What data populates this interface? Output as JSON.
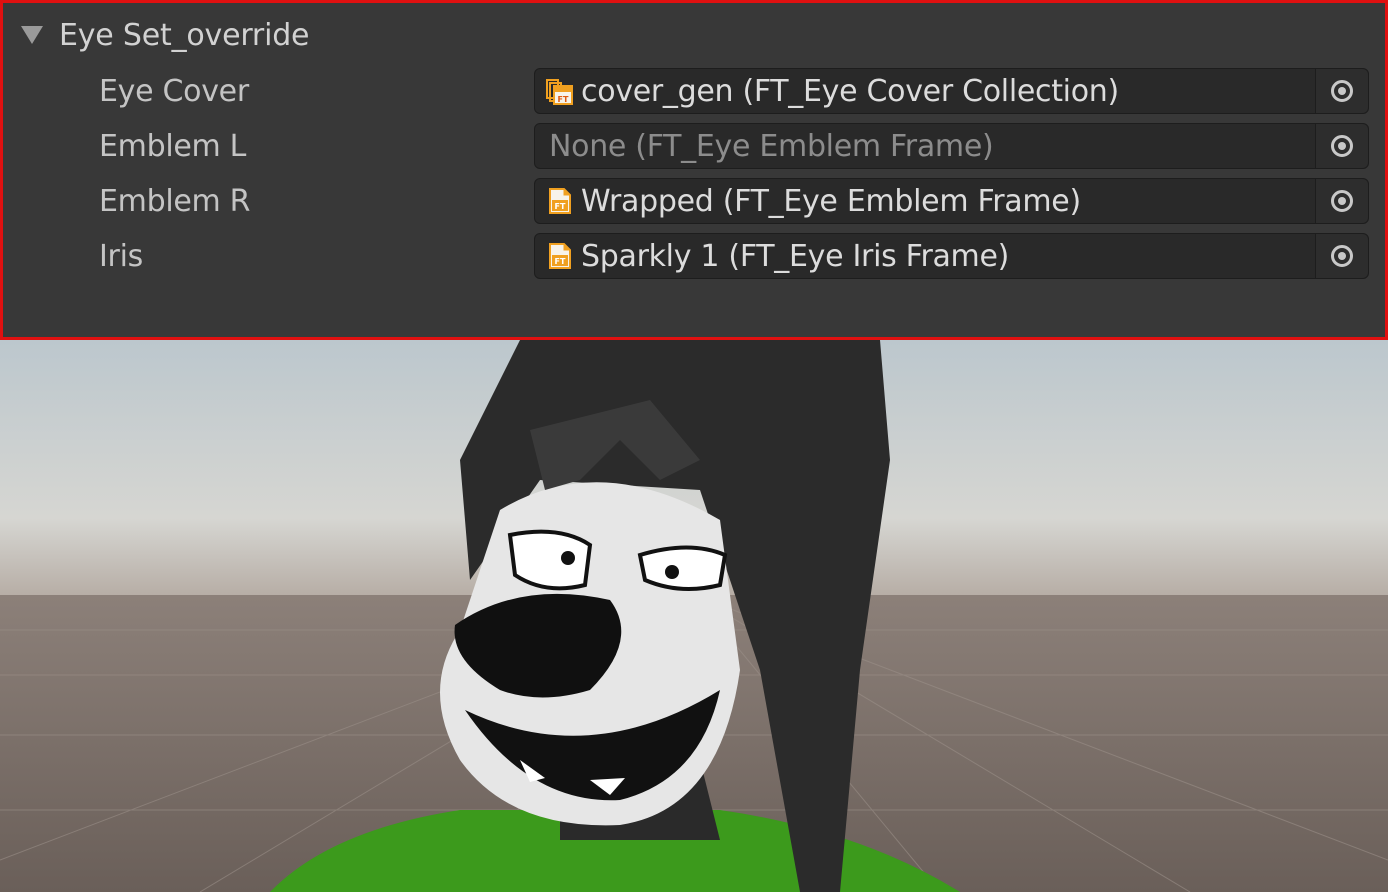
{
  "inspector": {
    "foldout": {
      "title": "Eye Set_override",
      "icon": "triangle-down-icon"
    },
    "fields": [
      {
        "label": "Eye Cover",
        "value": "cover_gen (FT_Eye Cover Collection)",
        "icon": "collection-asset-icon"
      },
      {
        "label": "Emblem L",
        "value": "None (FT_Eye Emblem Frame)",
        "icon": ""
      },
      {
        "label": "Emblem R",
        "value": "Wrapped (FT_Eye Emblem Frame)",
        "icon": "frame-asset-icon"
      },
      {
        "label": "Iris",
        "value": "Sparkly 1 (FT_Eye Iris Frame)",
        "icon": "frame-asset-icon"
      }
    ],
    "picker_icon": "object-picker-icon",
    "asset_icon_text": "FT"
  },
  "colors": {
    "highlight_border": "#e01010",
    "panel_bg": "#383838",
    "field_bg": "#292929",
    "icon_orange": "#f0a020"
  }
}
